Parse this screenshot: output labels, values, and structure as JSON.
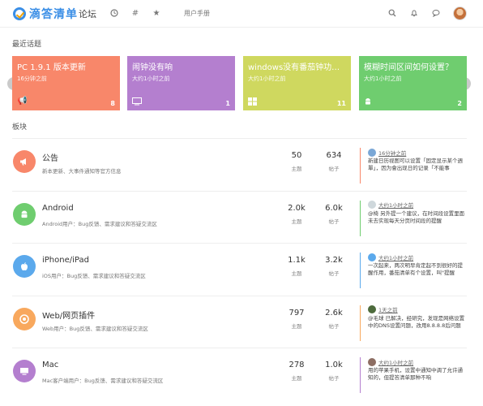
{
  "header": {
    "logo_text": "滴答清单",
    "forum_label": "论坛",
    "user_manual": "用户手册"
  },
  "sections": {
    "recent": "最近话题",
    "boards": "板块"
  },
  "carousel": [
    {
      "title": "PC 1.9.1 版本更新",
      "time": "16分钟之前",
      "count": "8",
      "color": "#f8876a",
      "icon": "megaphone-icon"
    },
    {
      "title": "闹钟没有响",
      "time": "大约1小时之前",
      "count": "1",
      "color": "#b47fcf",
      "icon": "monitor-icon"
    },
    {
      "title": "windows没有番茄钟功能吗？",
      "time": "大约1小时之前",
      "count": "11",
      "color": "#cfd85f",
      "icon": "windows-icon"
    },
    {
      "title": "模糊时间区间如何设置？",
      "time": "大约1小时之前",
      "count": "2",
      "color": "#6fcd6f",
      "icon": "android-icon"
    }
  ],
  "forums": [
    {
      "name": "公告",
      "desc": "新本更新、大事件通知等官方信息",
      "topics": "50",
      "posts": "634",
      "topics_label": "主题",
      "posts_label": "帖子",
      "color": "#f8876a",
      "icon": "megaphone-icon",
      "latest_time": "16分钟之前",
      "latest_text": "新建日历视图可以设置「固定显示某个週單」，因为會出现日的记录「不能事",
      "accent": "#f8876a"
    },
    {
      "name": "Android",
      "desc": "Android用户：Bug反馈、需求建议和答疑交流区",
      "topics": "2.0k",
      "posts": "6.0k",
      "topics_label": "主题",
      "posts_label": "帖子",
      "color": "#6fcd6f",
      "icon": "android-icon",
      "latest_time": "大约1小时之前",
      "latest_text": "@椅 另外提一个建议，在时间段设置里面未去实现每天分页时间段的提醒",
      "accent": "#6fcd6f"
    },
    {
      "name": "iPhone/iPad",
      "desc": "iOS用户：Bug反馈、需求建议和答疑交流区",
      "topics": "1.1k",
      "posts": "3.2k",
      "topics_label": "主题",
      "posts_label": "帖子",
      "color": "#5ba9ec",
      "icon": "apple-icon",
      "latest_time": "大约1小时之前",
      "latest_text": "一次起来，两次明早肯定起不到很好的提醒作用，番茄清单有个设置，叫\"提醒",
      "accent": "#5ba9ec"
    },
    {
      "name": "Web/网页插件",
      "desc": "Web用户：Bug反馈、需求建议和答疑交流区",
      "topics": "797",
      "posts": "2.6k",
      "topics_label": "主题",
      "posts_label": "帖子",
      "color": "#f8a85d",
      "icon": "chrome-icon",
      "latest_time": "1天之前",
      "latest_text": "@毛球 已解决，经研究，发现是网络设置中的DNS设置问题，改用8.8.8.8后问题",
      "accent": "#f8a85d"
    },
    {
      "name": "Mac",
      "desc": "Mac客户端用户：Bug反馈、需求建议和答疑交流区",
      "topics": "278",
      "posts": "1.0k",
      "topics_label": "主题",
      "posts_label": "帖子",
      "color": "#b47fcf",
      "icon": "monitor-icon",
      "latest_time": "大约1小时之前",
      "latest_text": "用的苹果手机，设置中通知中调了允许通知的，但提答清单那种不响",
      "accent": "#b47fcf"
    }
  ]
}
